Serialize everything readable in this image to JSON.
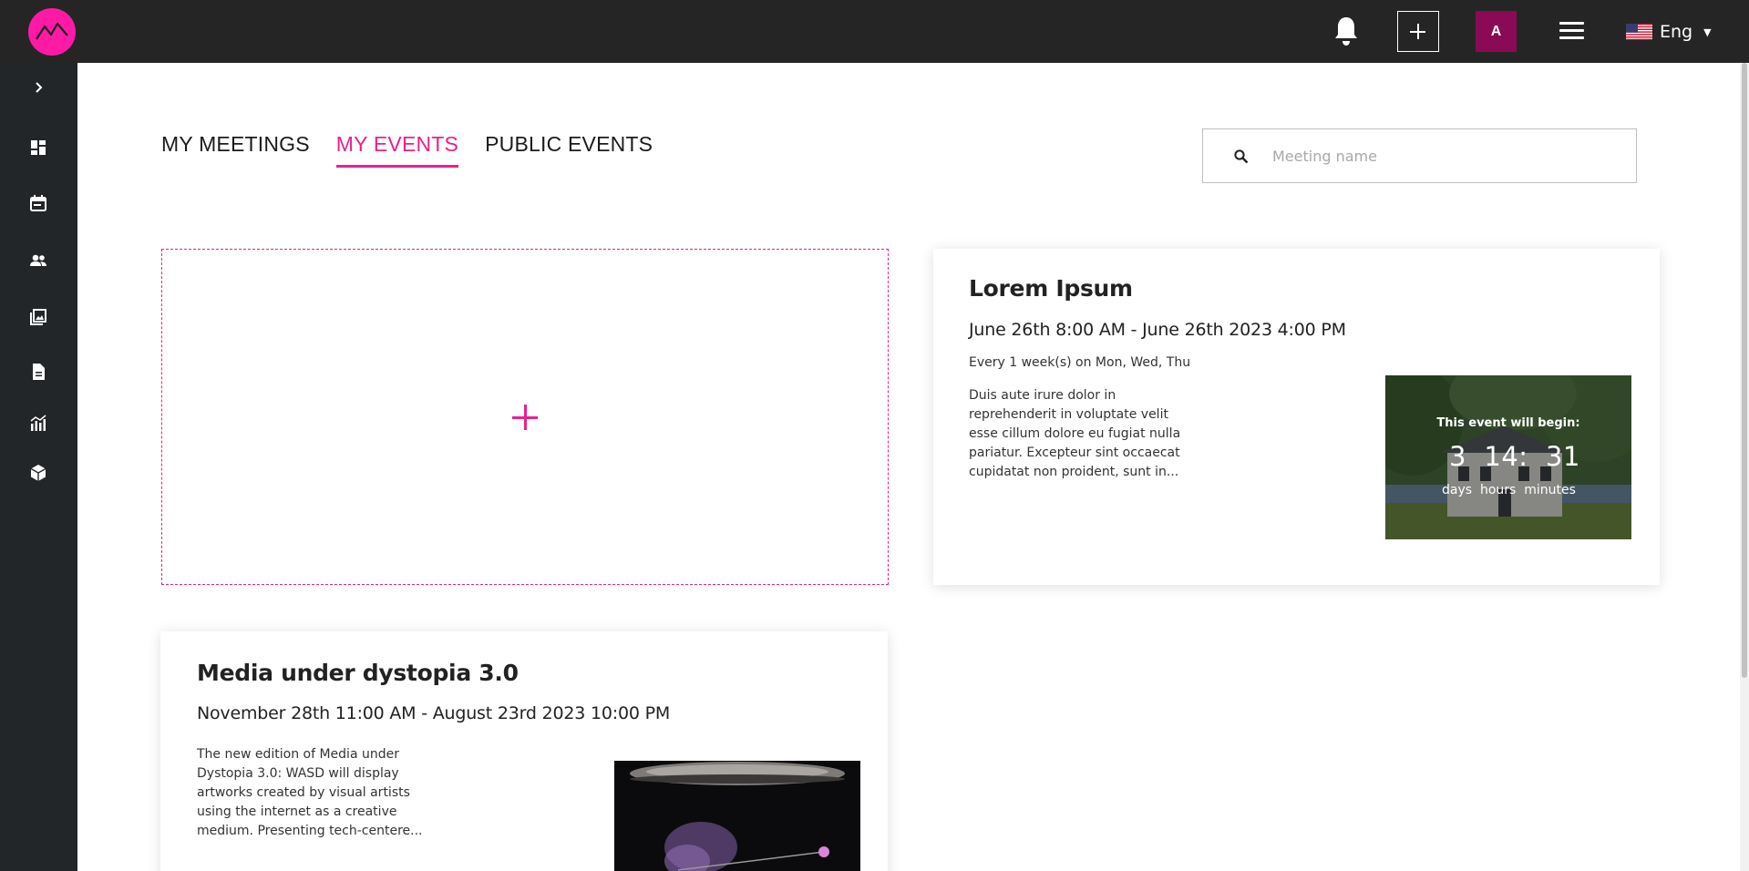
{
  "header": {
    "avatar_letter": "A",
    "language": "Eng"
  },
  "tabs": [
    {
      "label": "MY MEETINGS",
      "active": false
    },
    {
      "label": "MY EVENTS",
      "active": true
    },
    {
      "label": "PUBLIC EVENTS",
      "active": false
    }
  ],
  "search": {
    "placeholder": "Meeting name"
  },
  "events": [
    {
      "title": "Lorem Ipsum",
      "dates": "June 26th 8:00 AM - June 26th 2023 4:00 PM",
      "recurrence": "Every 1 week(s) on Mon, Wed, Thu",
      "description": "Duis aute irure dolor in reprehenderit in voluptate velit esse cillum dolore eu fugiat nulla pariatur. Excepteur sint occaecat cupidatat non proident, sunt in...",
      "countdown": {
        "label": "This event will begin:",
        "days": "3",
        "hours": "14",
        "minutes": "31",
        "separator": ":",
        "unit_days": "days",
        "unit_hours": "hours",
        "unit_minutes": "minutes"
      }
    },
    {
      "title": "Media under dystopia 3.0",
      "dates": "November 28th 11:00 AM - August 23rd 2023 10:00 PM",
      "description": "The new edition of Media under Dystopia 3.0: WASD will display artworks created by visual artists using the internet as a creative medium. Presenting tech-centere..."
    }
  ],
  "colors": {
    "accent": "#e8218c",
    "topbar": "#252525",
    "sidebar": "#232629",
    "avatar_bg": "#8a0a55",
    "logo": "#ff1aa6"
  },
  "icons": {
    "sidebar": [
      "chevron-right-icon",
      "dashboard-icon",
      "calendar-icon",
      "people-icon",
      "gallery-icon",
      "document-icon",
      "analytics-icon",
      "cube-icon"
    ],
    "header": [
      "bell-icon",
      "plus-icon",
      "menu-icon",
      "us-flag-icon",
      "caret-down-icon"
    ],
    "search": "search-icon"
  }
}
